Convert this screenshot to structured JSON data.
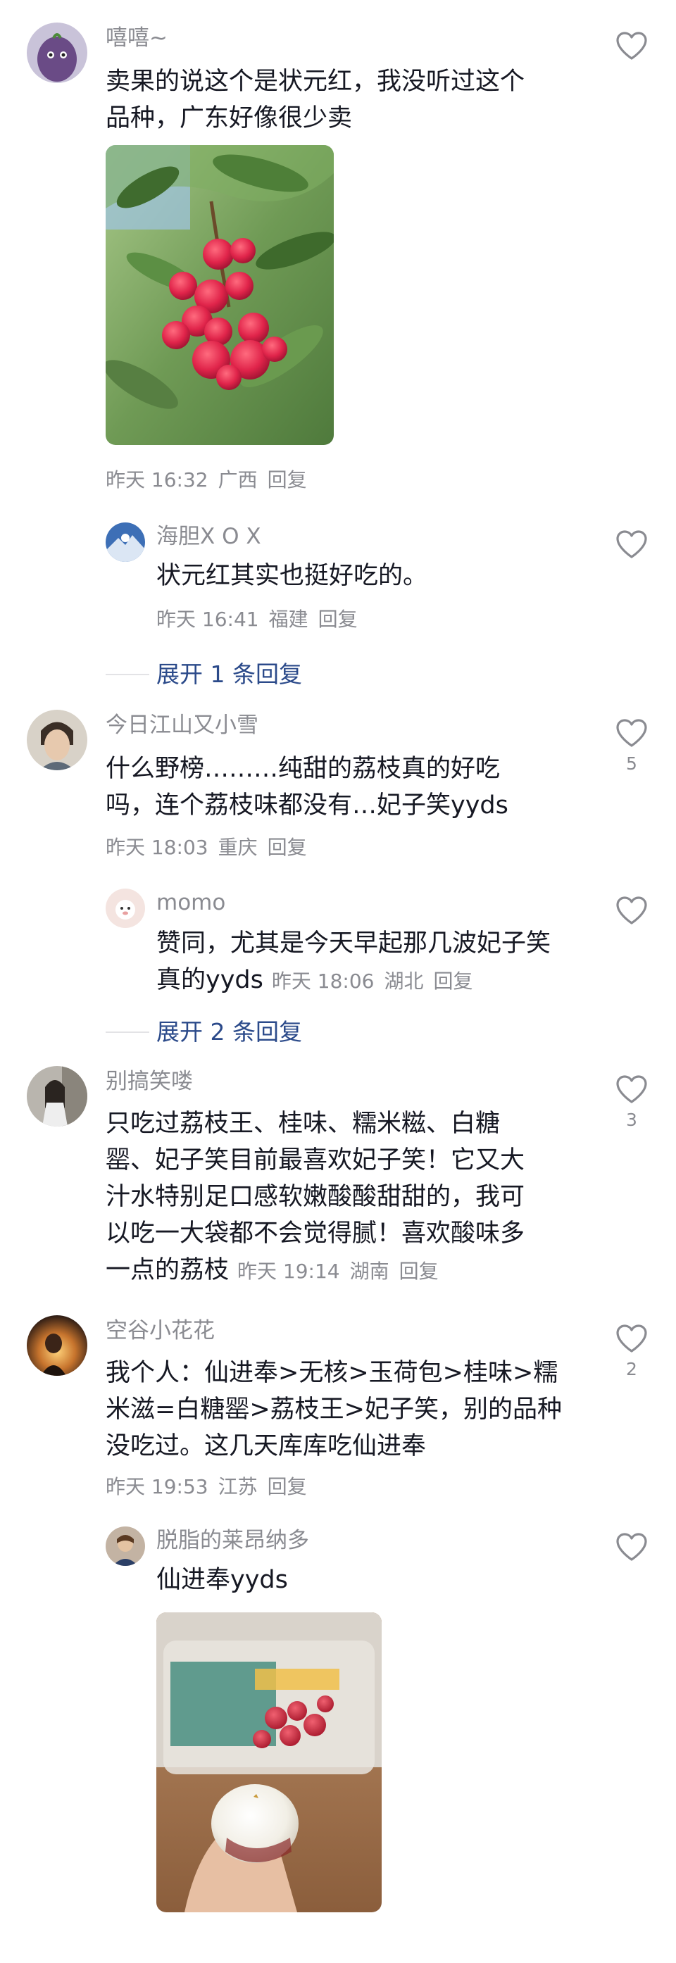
{
  "comments": [
    {
      "user": "嘻嘻~",
      "lines": [
        "卖果的说这个是状元红，我没听过这个",
        "品种，广东好像很少卖"
      ],
      "time": "昨天 16:32",
      "location": "广西",
      "reply": "回复",
      "likes": ""
    },
    {
      "user": "海胆X O X",
      "lines": [
        "状元红其实也挺好吃的。"
      ],
      "time": "昨天 16:41",
      "location": "福建",
      "reply": "回复",
      "likes": ""
    },
    {
      "user": "今日江山又小雪",
      "lines": [
        "什么野榜………纯甜的荔枝真的好吃",
        "吗，连个荔枝味都没有…妃子笑yyds"
      ],
      "time": "昨天 18:03",
      "location": "重庆",
      "reply": "回复",
      "likes": "5"
    },
    {
      "user": "momo",
      "lines": [
        "赞同，尤其是今天早起那几波妃子笑",
        "真的yyds"
      ],
      "time": "昨天 18:06",
      "location": "湖北",
      "reply": "回复",
      "likes": ""
    },
    {
      "user": "别搞笑喽",
      "lines": [
        "只吃过荔枝王、桂味、糯米糍、白糖",
        "罂、妃子笑目前最喜欢妃子笑！它又大",
        "汁水特别足口感软嫩酸酸甜甜的，我可",
        "以吃一大袋都不会觉得腻！喜欢酸味多",
        "一点的荔枝"
      ],
      "time": "昨天 19:14",
      "location": "湖南",
      "reply": "回复",
      "likes": "3"
    },
    {
      "user": "空谷小花花",
      "lines": [
        "我个人：仙进奉>无核>玉荷包>桂味>糯",
        "米滋=白糖罂>荔枝王>妃子笑，别的品种",
        "没吃过。这几天库库吃仙进奉"
      ],
      "time": "昨天 19:53",
      "location": "江苏",
      "reply": "回复",
      "likes": "2"
    },
    {
      "user": "脱脂的莱昂纳多",
      "lines": [
        "仙进奉yyds"
      ],
      "likes": ""
    }
  ],
  "expanders": [
    "展开 1 条回复",
    "展开 2 条回复"
  ],
  "colors": {
    "meta": "#8a8b91",
    "expand": "#2b4a8a",
    "text": "#161823"
  },
  "icons": {
    "like": "heart-outline-icon"
  }
}
